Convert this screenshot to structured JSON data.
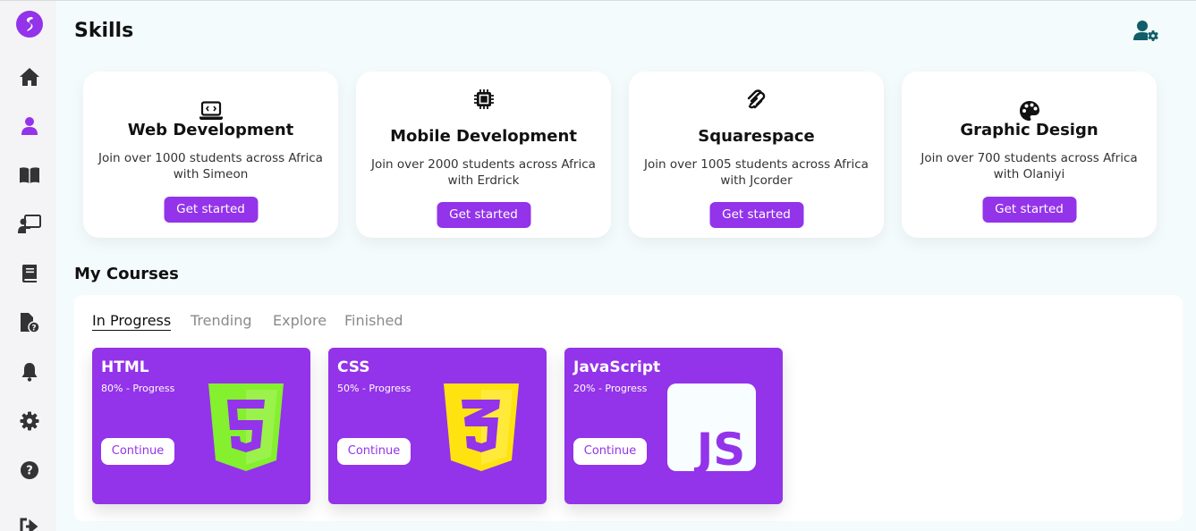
{
  "page": {
    "title": "Skills"
  },
  "colors": {
    "accent": "#9333ea",
    "html_logo": "#84f02e",
    "css_logo": "#ffe311",
    "js_bg": "#f8feff",
    "teal_icon": "#0f5e69"
  },
  "sidebar": {
    "items": [
      {
        "icon": "home-icon"
      },
      {
        "icon": "user-icon",
        "active": true
      },
      {
        "icon": "book-open-icon"
      },
      {
        "icon": "chalkboard-teacher-icon"
      },
      {
        "icon": "book-icon"
      },
      {
        "icon": "file-question-icon"
      },
      {
        "icon": "bell-icon"
      },
      {
        "icon": "gear-icon"
      },
      {
        "icon": "question-circle-icon"
      },
      {
        "icon": "logout-icon"
      }
    ]
  },
  "skills": [
    {
      "icon": "laptop-code-icon",
      "title": "Web Development",
      "desc": "Join over 1000 students across Africa with Simeon",
      "button": "Get started"
    },
    {
      "icon": "chip-icon",
      "title": "Mobile Development",
      "desc": "Join over 2000 students across Africa with Erdrick",
      "button": "Get started"
    },
    {
      "icon": "squarespace-icon",
      "title": "Squarespace",
      "desc": "Join over 1005 students across Africa with Jcorder",
      "button": "Get started"
    },
    {
      "icon": "palette-icon",
      "title": "Graphic Design",
      "desc": "Join over 700 students across Africa with Olaniyi",
      "button": "Get started"
    }
  ],
  "my_courses": {
    "title": "My Courses",
    "tabs": [
      "In Progress",
      "Trending",
      "Explore",
      "Finished"
    ],
    "active_tab": "In Progress",
    "courses": [
      {
        "name": "HTML",
        "progress": "80% - Progress",
        "button": "Continue",
        "logo": "html5-logo",
        "logo_text": "5"
      },
      {
        "name": "CSS",
        "progress": "50% - Progress",
        "button": "Continue",
        "logo": "css3-logo",
        "logo_text": "3"
      },
      {
        "name": "JavaScript",
        "progress": "20% - Progress",
        "button": "Continue",
        "logo": "js-logo",
        "logo_text": "JS"
      }
    ]
  }
}
